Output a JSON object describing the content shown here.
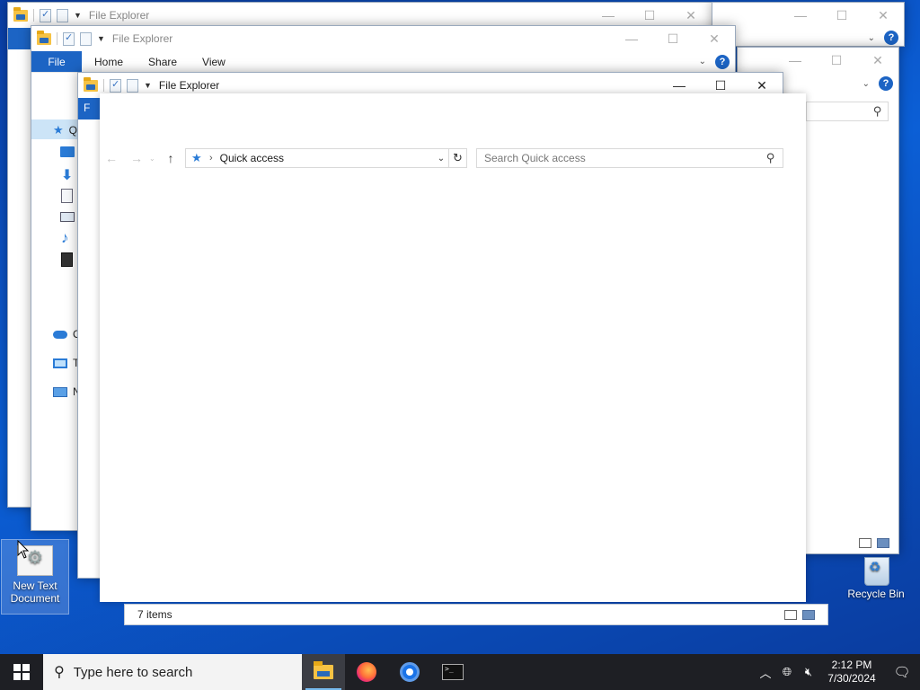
{
  "windows": {
    "title": "File Explorer",
    "file_tab": "File",
    "ribbon_tabs": [
      "Home",
      "Share",
      "View"
    ],
    "help_label": "?",
    "minimize_glyph": "—",
    "maximize_glyph": "☐",
    "close_glyph": "✕"
  },
  "front": {
    "address_text": "Quick access",
    "search_placeholder": "Search Quick access",
    "back_glyph": "←",
    "forward_glyph": "→",
    "recent_glyph": "⌄",
    "up_glyph": "↑",
    "crumb_sep": "›",
    "dropdown_glyph": "⌄",
    "refresh_glyph": "↻"
  },
  "back_nav": {
    "letters": [
      "Q",
      "O",
      "T",
      "N"
    ]
  },
  "status": {
    "items_text": "7 items"
  },
  "desktop": {
    "new_text_document": "New Text Document",
    "recycle_bin": "Recycle Bin"
  },
  "taskbar": {
    "search_placeholder": "Type here to search",
    "time": "2:12 PM",
    "date": "7/30/2024",
    "terminal_glyph": ">_"
  },
  "colors": {
    "accent": "#1c64c4",
    "taskbar": "#1e1f24"
  }
}
